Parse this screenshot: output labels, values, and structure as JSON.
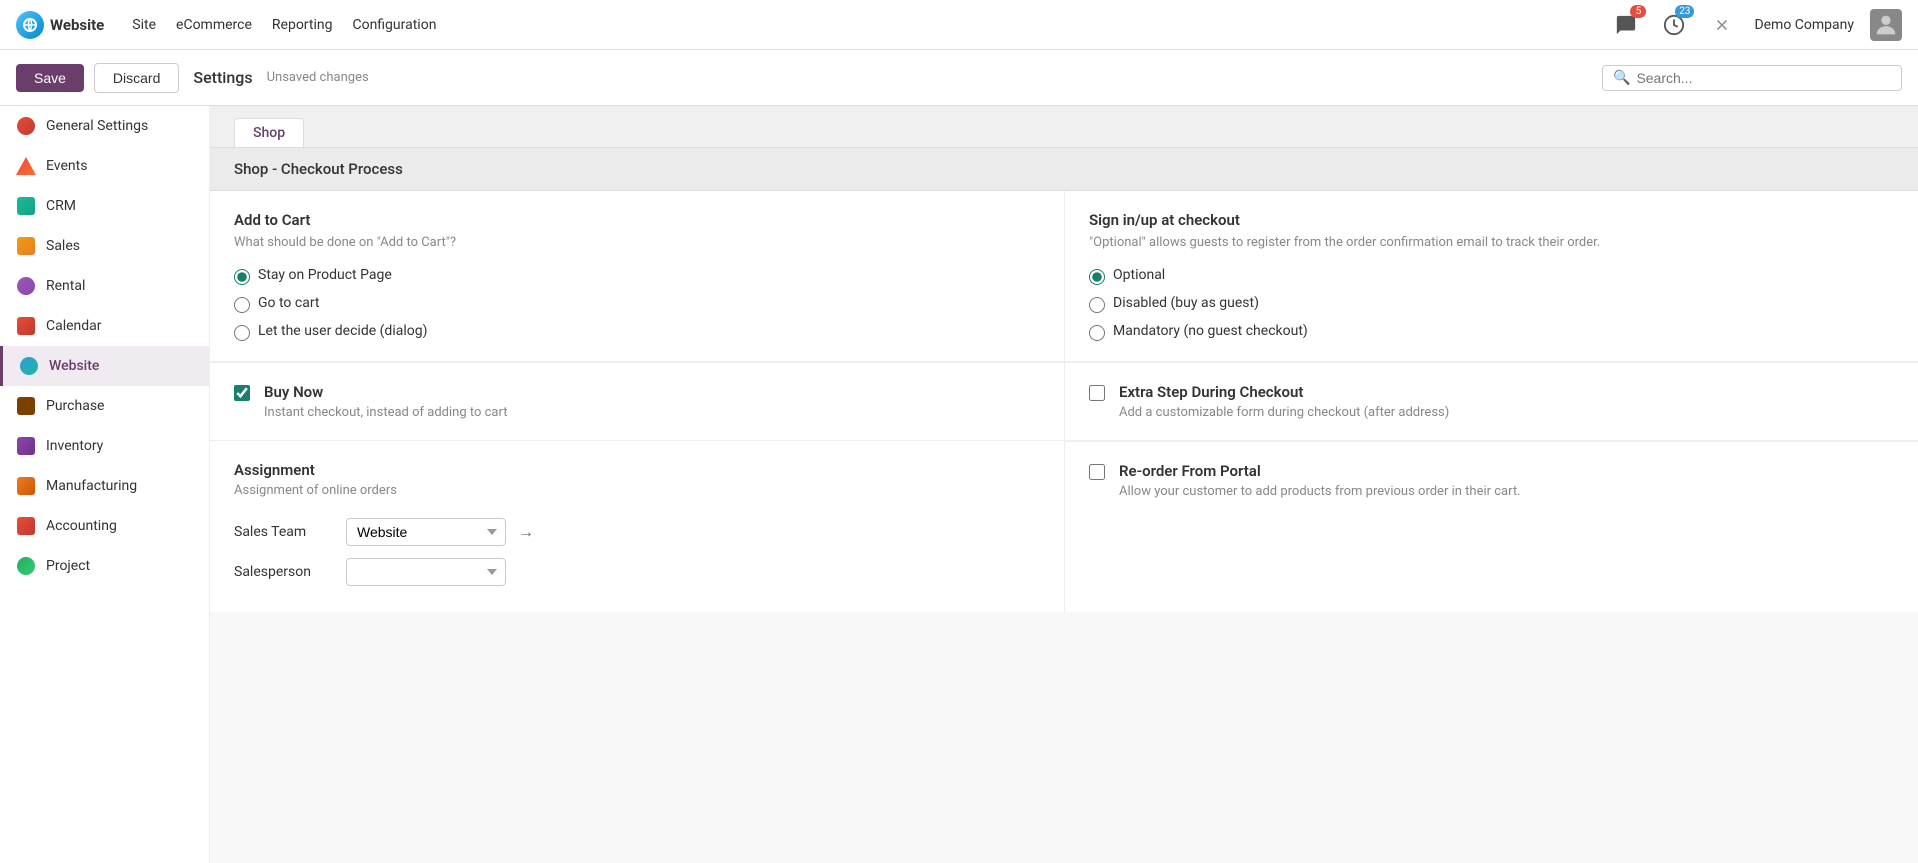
{
  "app": {
    "logo_text": "Website",
    "nav_links": [
      "Site",
      "eCommerce",
      "Reporting",
      "Configuration"
    ],
    "notifications_count": 5,
    "activities_count": 23,
    "company": "Demo Company"
  },
  "toolbar": {
    "save_label": "Save",
    "discard_label": "Discard",
    "page_title": "Settings",
    "unsaved": "Unsaved changes",
    "search_placeholder": "Search..."
  },
  "sidebar": {
    "items": [
      {
        "id": "general-settings",
        "label": "General Settings"
      },
      {
        "id": "events",
        "label": "Events"
      },
      {
        "id": "crm",
        "label": "CRM"
      },
      {
        "id": "sales",
        "label": "Sales"
      },
      {
        "id": "rental",
        "label": "Rental"
      },
      {
        "id": "calendar",
        "label": "Calendar"
      },
      {
        "id": "website",
        "label": "Website"
      },
      {
        "id": "purchase",
        "label": "Purchase"
      },
      {
        "id": "inventory",
        "label": "Inventory"
      },
      {
        "id": "manufacturing",
        "label": "Manufacturing"
      },
      {
        "id": "accounting",
        "label": "Accounting"
      },
      {
        "id": "project",
        "label": "Project"
      }
    ]
  },
  "content": {
    "section_title": "Shop - Checkout Process",
    "add_to_cart": {
      "title": "Add to Cart",
      "description": "What should be done on \"Add to Cart\"?",
      "options": [
        {
          "id": "stay",
          "label": "Stay on Product Page",
          "checked": true
        },
        {
          "id": "go",
          "label": "Go to cart",
          "checked": false
        },
        {
          "id": "decide",
          "label": "Let the user decide (dialog)",
          "checked": false
        }
      ]
    },
    "sign_in": {
      "title": "Sign in/up at checkout",
      "description": "\"Optional\" allows guests to register from the order confirmation email to track their order.",
      "options": [
        {
          "id": "optional",
          "label": "Optional",
          "checked": true
        },
        {
          "id": "disabled",
          "label": "Disabled (buy as guest)",
          "checked": false
        },
        {
          "id": "mandatory",
          "label": "Mandatory (no guest checkout)",
          "checked": false
        }
      ]
    },
    "buy_now": {
      "title": "Buy Now",
      "description": "Instant checkout, instead of adding to cart",
      "checked": true
    },
    "extra_step": {
      "title": "Extra Step During Checkout",
      "description": "Add a customizable form during checkout (after address)",
      "checked": false
    },
    "assignment": {
      "title": "Assignment",
      "description": "Assignment of online orders"
    },
    "reorder": {
      "title": "Re-order From Portal",
      "description": "Allow your customer to add products from previous order in their cart.",
      "checked": false
    },
    "sales_team": {
      "label": "Sales Team",
      "value": "Website"
    },
    "salesperson": {
      "label": "Salesperson",
      "value": ""
    }
  }
}
